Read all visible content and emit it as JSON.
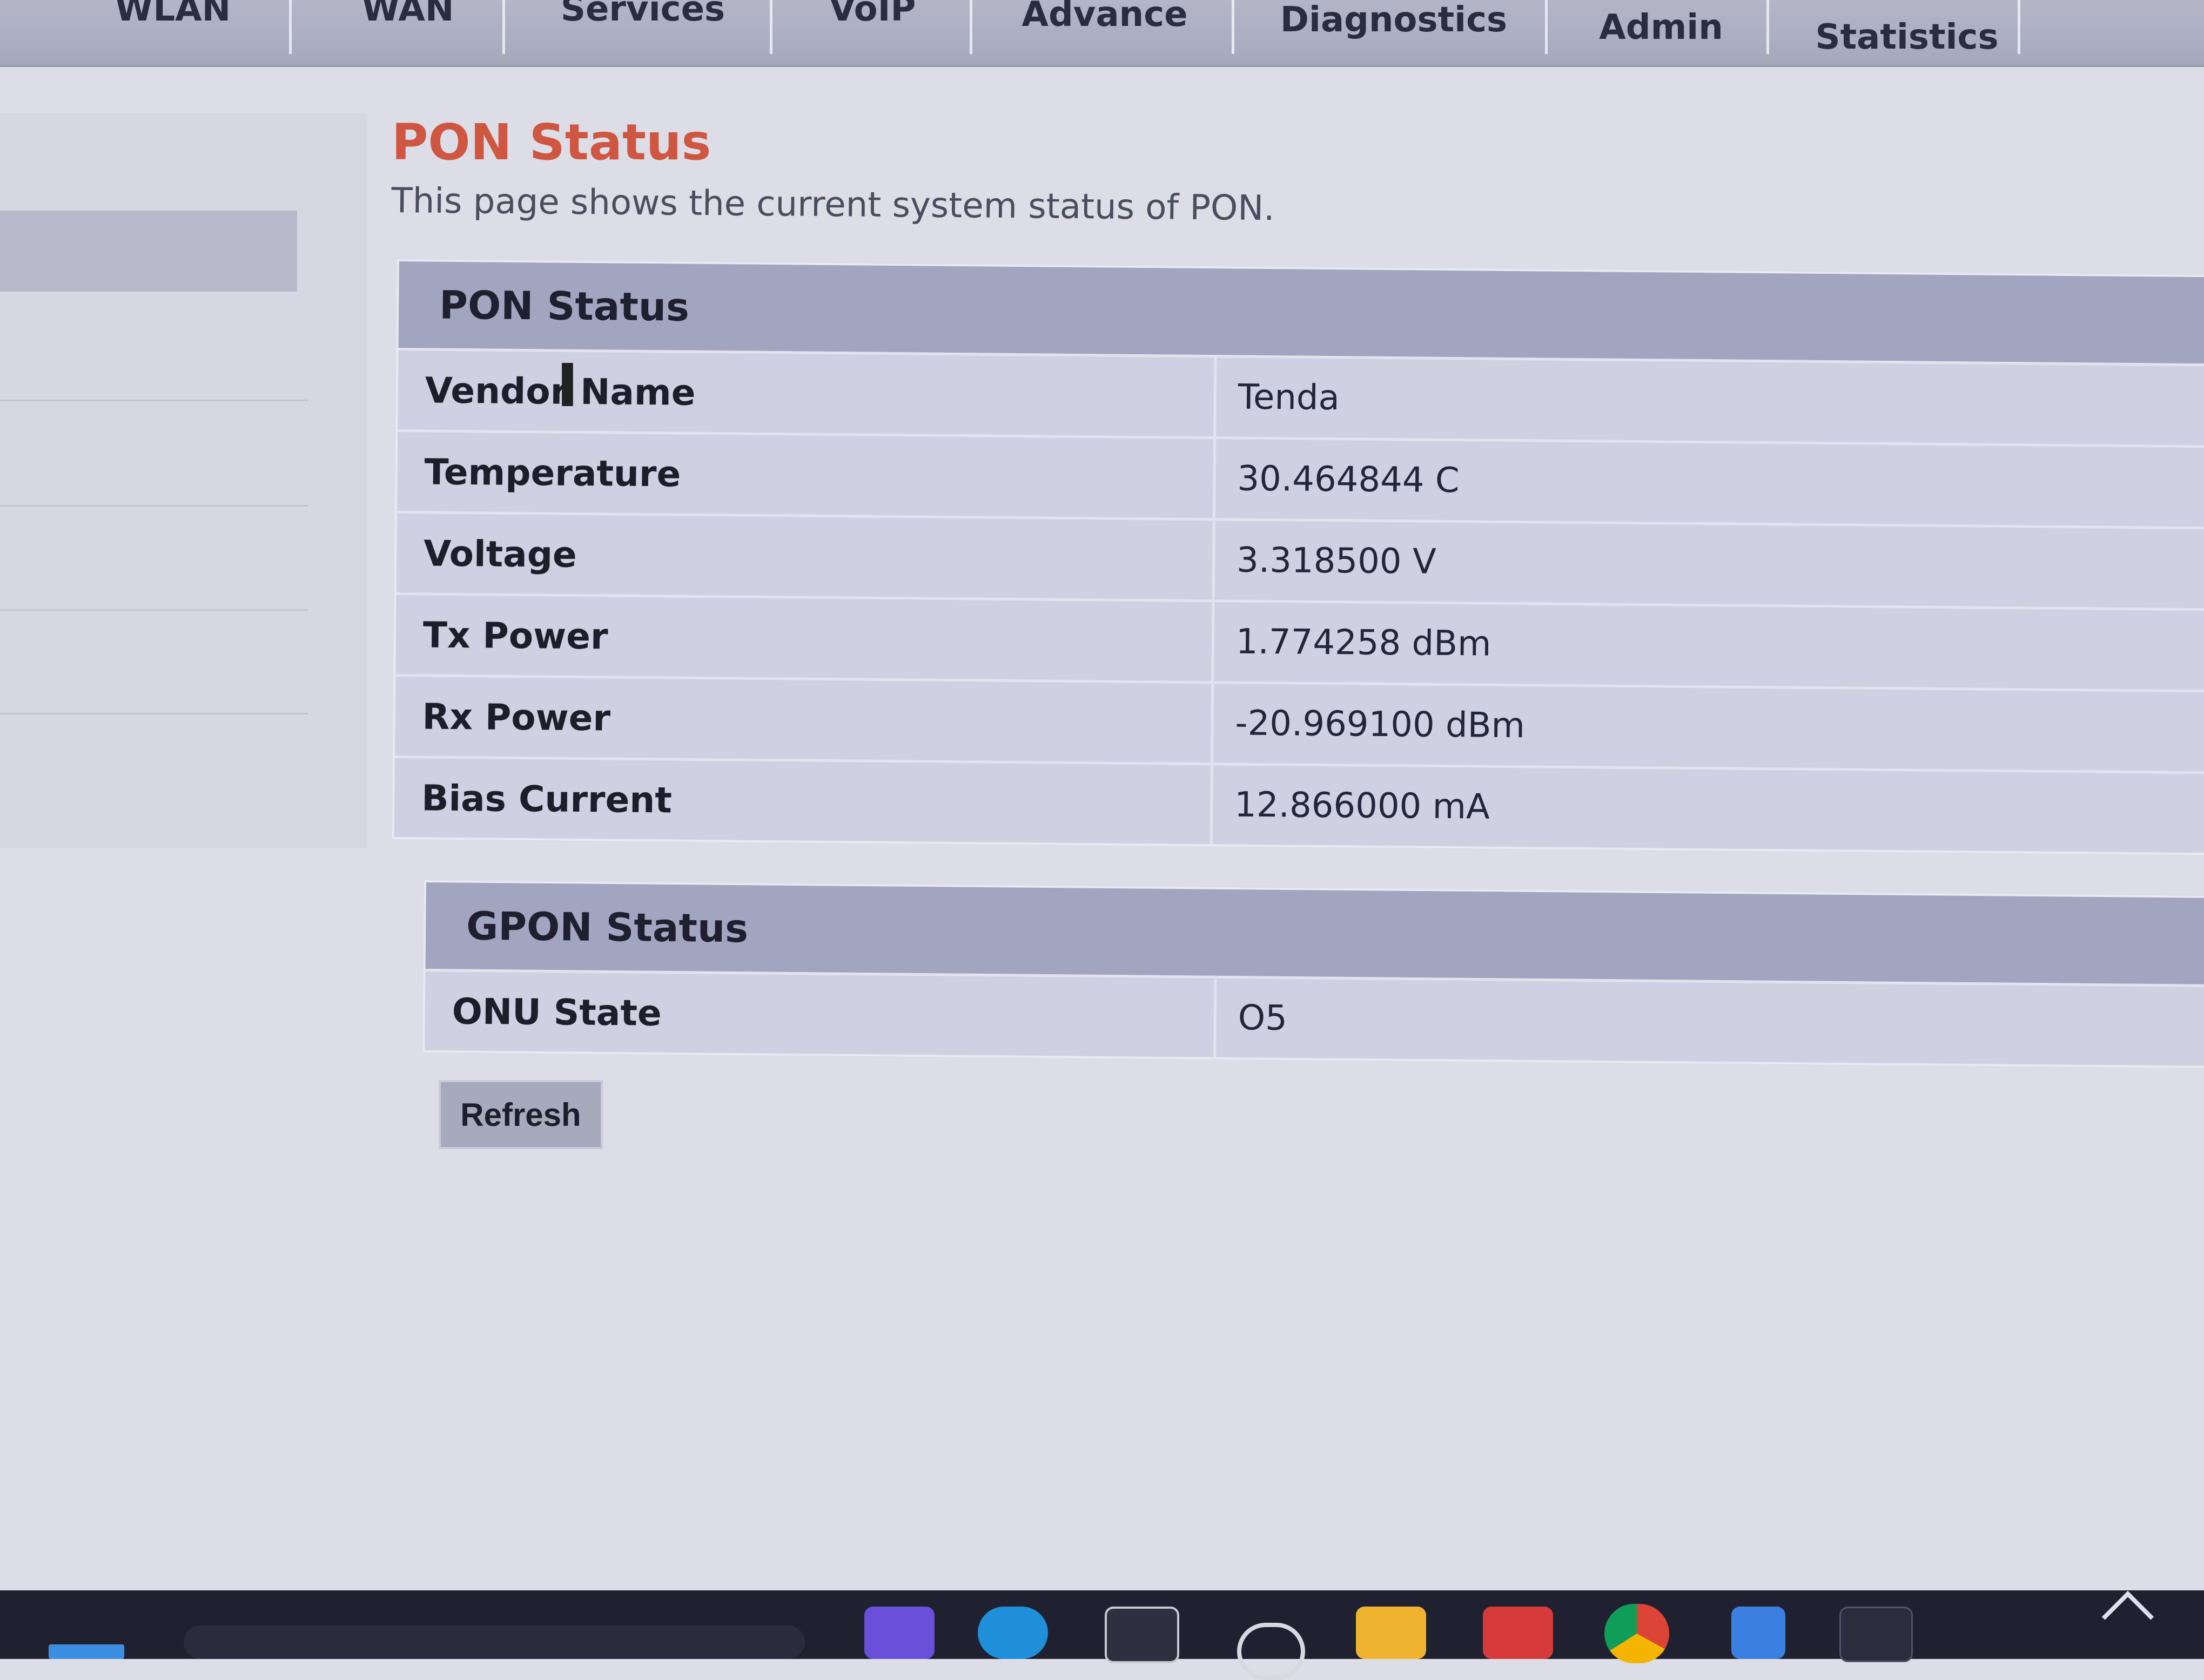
{
  "nav": {
    "tabs": [
      {
        "label": "WLAN"
      },
      {
        "label": "WAN"
      },
      {
        "label": "Services"
      },
      {
        "label": "VoIP"
      },
      {
        "label": "Advance"
      },
      {
        "label": "Diagnostics"
      },
      {
        "label": "Admin"
      },
      {
        "label": "Statistics"
      }
    ]
  },
  "page": {
    "title": "PON Status",
    "description": "This page shows the current system status of PON."
  },
  "pon_status": {
    "heading": "PON Status",
    "rows": [
      {
        "label": "Vendor Name",
        "value": "Tenda"
      },
      {
        "label": "Temperature",
        "value": "30.464844 C"
      },
      {
        "label": "Voltage",
        "value": "3.318500 V"
      },
      {
        "label": "Tx Power",
        "value": "1.774258 dBm"
      },
      {
        "label": "Rx Power",
        "value": "-20.969100 dBm"
      },
      {
        "label": "Bias Current",
        "value": "12.866000 mA"
      }
    ]
  },
  "gpon_status": {
    "heading": "GPON Status",
    "rows": [
      {
        "label": "ONU State",
        "value": "O5"
      }
    ]
  },
  "buttons": {
    "refresh_label": "Refresh"
  },
  "colors": {
    "title_accent": "#cf5641",
    "panel_header": "#a2a5bf",
    "taskbar": "#1f2030"
  },
  "icons": {
    "cursor": "text-cursor-icon"
  }
}
